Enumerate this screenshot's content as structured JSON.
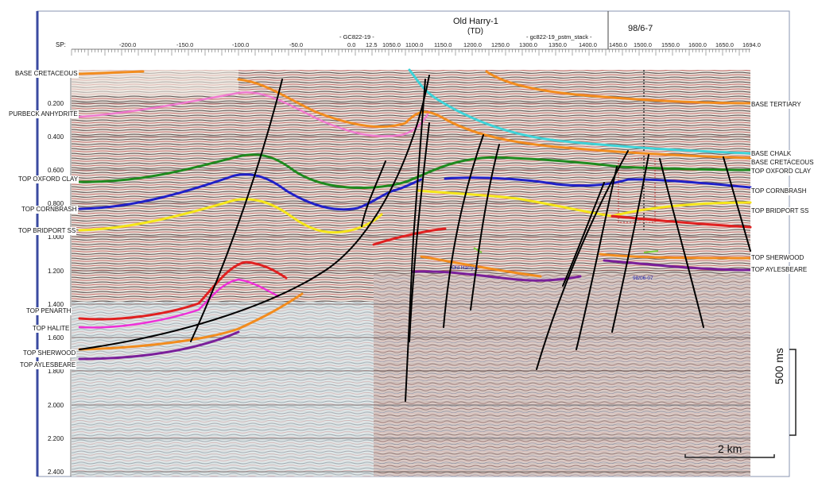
{
  "header": {
    "well_name": "Old Harry-1",
    "well_td": "(TD)",
    "line_left": "- GC822-19 -",
    "line_right": "- gc822-19_pstm_stack -",
    "block_id": "98/6-7",
    "sp_label": "SP:"
  },
  "sp_ticks": [
    "-200.0",
    "-150.0",
    "-100.0",
    "-50.0",
    "0.0",
    "12.5",
    "1050.0",
    "1100.0",
    "1150.0",
    "1200.0",
    "1250.0",
    "1300.0",
    "1350.0",
    "1400.0",
    "1450.0",
    "1500.0",
    "1550.0",
    "1600.0",
    "1650.0",
    "1694.0"
  ],
  "time_ticks": [
    "0.200",
    "0.400",
    "0.600",
    "0.800",
    "1.000",
    "1.200",
    "1.400",
    "1.600",
    "1.800",
    "2.000",
    "2.200",
    "2.400"
  ],
  "left_labels": [
    {
      "text": "BASE CRETACEOUS"
    },
    {
      "text": "PURBECK ANHYDRITE"
    },
    {
      "text": "TOP OXFORD CLAY"
    },
    {
      "text": "TOP CORNBRASH"
    },
    {
      "text": "TOP BRIDPORT SS"
    },
    {
      "text": "TOP PENARTH"
    },
    {
      "text": "TOP HALITE"
    },
    {
      "text": "TOP SHERWOOD"
    },
    {
      "text": "TOP AYLESBEARE"
    }
  ],
  "right_labels": [
    {
      "text": "BASE TERTIARY"
    },
    {
      "text": "BASE CHALK"
    },
    {
      "text": "BASE CRETACEOUS"
    },
    {
      "text": "TOP OXFORD CLAY"
    },
    {
      "text": "TOP CORNBRASH"
    },
    {
      "text": "TOP BRIDPORT SS"
    },
    {
      "text": "TOP SHERWOOD"
    },
    {
      "text": "TOP AYLESBEARE"
    }
  ],
  "well_labels": {
    "old_harry": "Old Harry-1",
    "well_98": "98/06-07"
  },
  "scale": {
    "vertical": "500 ms",
    "horizontal": "2 km"
  },
  "colors": {
    "base_tertiary": "#f28c1e",
    "base_chalk": "#3fd3d8",
    "base_cretaceous": "#f28c1e",
    "purbeck": "#f07ad0",
    "oxford_clay": "#1e8a1e",
    "cornbrash": "#2020c8",
    "bridport": "#f5e61a",
    "penarth": "#e02020",
    "halite": "#ee30d8",
    "sherwood": "#f28c1e",
    "aylesbeare": "#7a1f9a",
    "fault": "#000000"
  }
}
